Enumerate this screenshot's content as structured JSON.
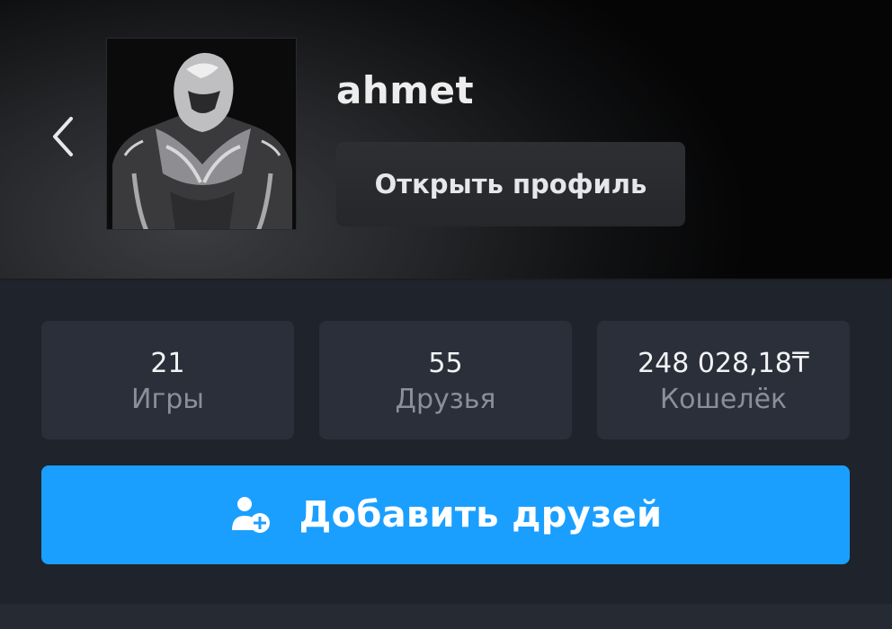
{
  "profile": {
    "username": "ahmet",
    "open_profile_label": "Открыть профиль"
  },
  "stats": {
    "games": {
      "value": "21",
      "label": "Игры"
    },
    "friends": {
      "value": "55",
      "label": "Друзья"
    },
    "wallet": {
      "value": "248 028,18₸",
      "label": "Кошелёк"
    }
  },
  "actions": {
    "add_friends_label": "Добавить друзей"
  },
  "icons": {
    "back": "chevron-left-icon",
    "add_friend": "add-user-icon"
  },
  "colors": {
    "accent": "#1a9fff",
    "panel": "#2b2f39",
    "background": "#1f232c"
  }
}
